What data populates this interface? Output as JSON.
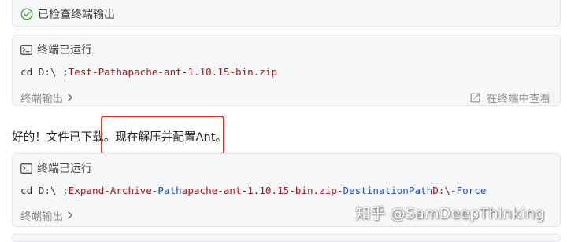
{
  "status_banner": {
    "text": "已检查终端输出",
    "icon": "check-circle-icon",
    "color": "#3fa535"
  },
  "terminal_block_1": {
    "header": "终端已运行",
    "command": {
      "part1": "cd D:\\ ; ",
      "part2": "Test-Path ",
      "part3": "apache-ant-1.10.15-bin.zip"
    },
    "output_link": "终端输出",
    "view_in_terminal": "在终端中查看"
  },
  "message": {
    "text": "好的！文件已下载。现在解压并配置Ant。"
  },
  "terminal_block_2": {
    "header": "终端已运行",
    "command": {
      "p1": "cd D:\\ ; ",
      "p2": "Expand-Archive ",
      "p3": "-Path ",
      "p4": "apache-ant-1.10.15-bin.zip ",
      "p5": "-DestinationPath ",
      "p6": "D:\\ ",
      "p7": "-Force"
    },
    "output_link": "终端输出"
  },
  "watermark": {
    "text": "知乎 @SamDeepThinking"
  },
  "colors": {
    "highlight_border": "#d9332b",
    "card_bg": "#f6f7f9"
  }
}
